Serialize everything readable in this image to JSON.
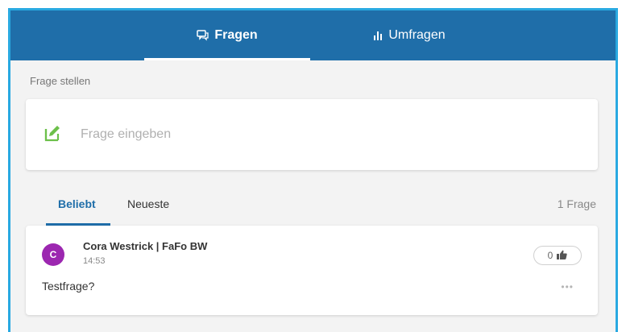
{
  "header": {
    "tabs": [
      {
        "label": "Fragen",
        "icon": "chat-bubbles-icon",
        "active": true
      },
      {
        "label": "Umfragen",
        "icon": "bar-chart-icon",
        "active": false
      }
    ]
  },
  "ask": {
    "section_label": "Frage stellen",
    "placeholder": "Frage eingeben",
    "icon": "edit-icon"
  },
  "filters": {
    "tabs": [
      {
        "label": "Beliebt",
        "active": true
      },
      {
        "label": "Neueste",
        "active": false
      }
    ],
    "count_label": "1 Frage"
  },
  "questions": [
    {
      "avatar_letter": "C",
      "author": "Cora Westrick | FaFo BW",
      "time": "14:53",
      "text": "Testfrage?",
      "likes": "0",
      "more_label": "•••"
    }
  ],
  "colors": {
    "header_bg": "#1f6ea9",
    "accent": "#1f6ea9",
    "frame_border": "#29a9e1",
    "edit_icon": "#6cc04a",
    "avatar": "#9c27b0"
  }
}
